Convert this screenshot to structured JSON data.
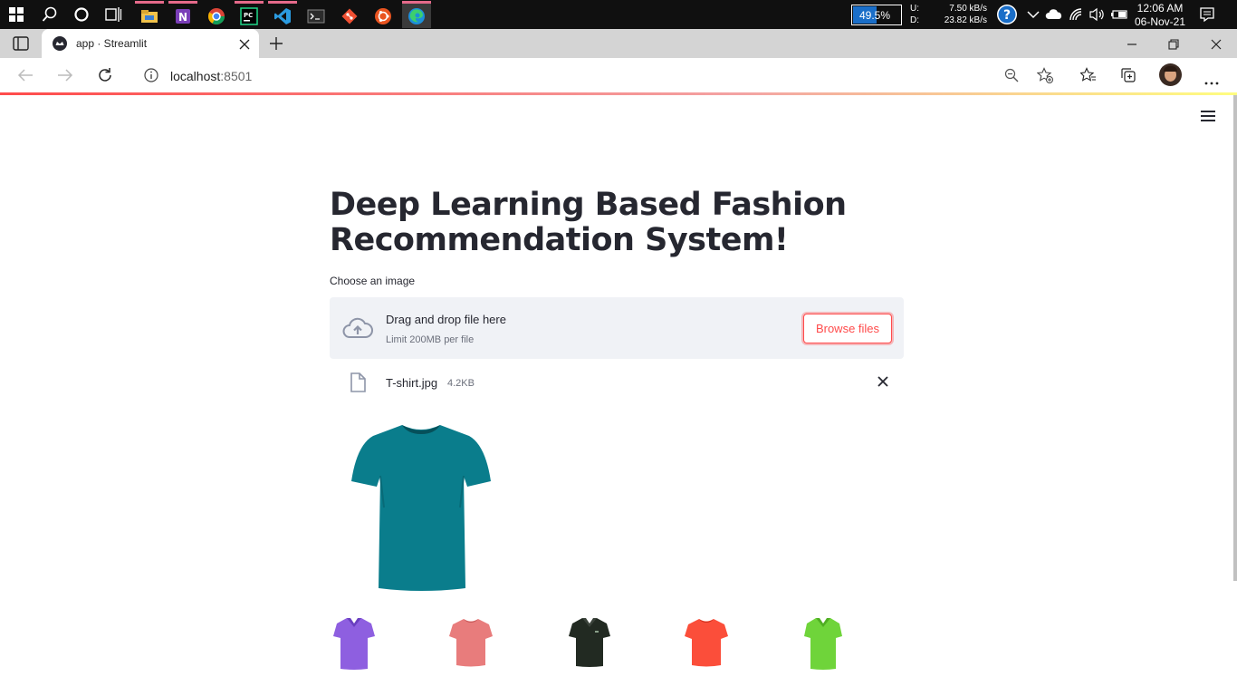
{
  "taskbar": {
    "battery": "49.5%",
    "net_up_label": "U:",
    "net_down_label": "D:",
    "net_up": "7.50 kB/s",
    "net_down": "23.82 kB/s",
    "time": "12:06 AM",
    "date": "06-Nov-21"
  },
  "browser": {
    "tab_title": "app · Streamlit",
    "url_host": "localhost",
    "url_port": ":8501"
  },
  "app": {
    "title": "Deep Learning Based Fashion Recommendation System!",
    "uploader_label": "Choose an image",
    "drop_text": "Drag and drop file here",
    "limit_text": "Limit 200MB per file",
    "browse_label": "Browse files",
    "file_name": "T-shirt.jpg",
    "file_size": "4.2KB",
    "main_image_color": "#0a7d8c",
    "recommendations": [
      {
        "color": "#8e5fe0",
        "style": "polo"
      },
      {
        "color": "#e87c7c",
        "style": "tee"
      },
      {
        "color": "#222a22",
        "style": "polo"
      },
      {
        "color": "#fb4e3a",
        "style": "tee"
      },
      {
        "color": "#6fd43a",
        "style": "polo"
      }
    ]
  },
  "colors": {
    "accent": "#ff4b4b",
    "text": "#262730",
    "dropzone_bg": "#f0f2f6"
  }
}
